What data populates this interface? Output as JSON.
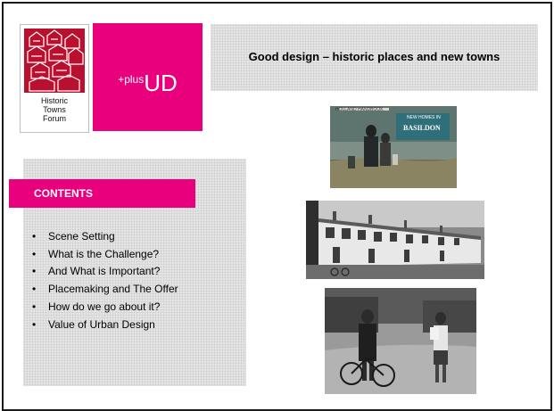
{
  "title": "Good design – historic places and new towns",
  "logos": {
    "htf": {
      "line1": "Historic",
      "line2": "Towns",
      "line3": "Forum"
    },
    "plusud": {
      "prefix": "+plus",
      "main": "UD"
    }
  },
  "contents": {
    "heading": "CONTENTS",
    "bullet": "•",
    "items": [
      "Scene Setting",
      "What is the Challenge?",
      "And What is Important?",
      "Placemaking and The Offer",
      "How do we go about it?",
      "Value of Urban Design"
    ]
  },
  "photos": {
    "book_title": "NEW HOMES IN",
    "book_place": "BASILDON",
    "book_series": "HOLLAND HANDBOOK"
  },
  "colors": {
    "accent": "#e8007d",
    "panel": "#e4e4e4",
    "htf_red": "#b8102e"
  }
}
